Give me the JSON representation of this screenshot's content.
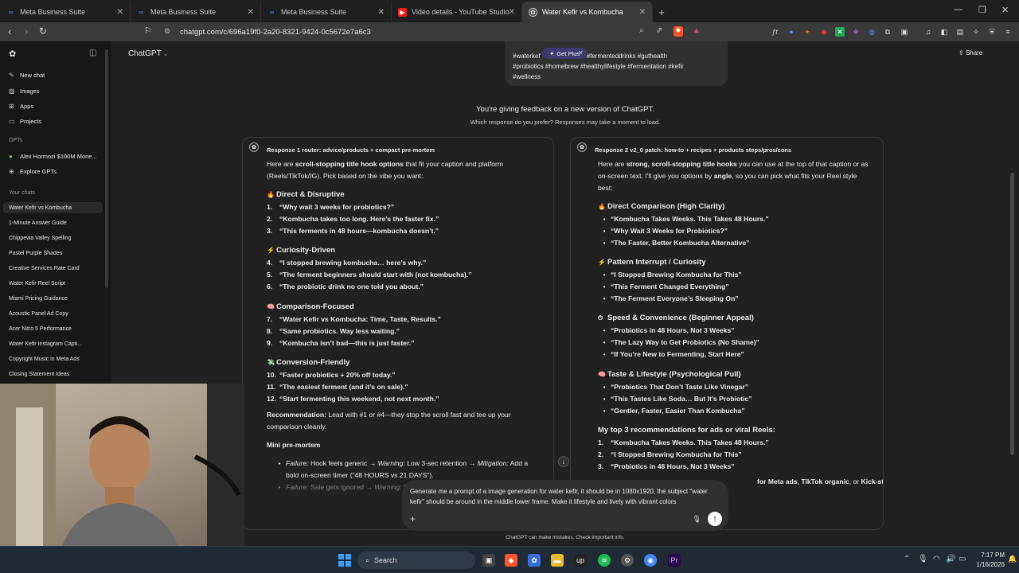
{
  "browser": {
    "tabs": [
      {
        "label": "Meta Business Suite",
        "icon": "meta-icon",
        "active": false
      },
      {
        "label": "Meta Business Suite",
        "icon": "meta-icon",
        "active": false
      },
      {
        "label": "Meta Business Suite",
        "icon": "meta-icon",
        "active": false
      },
      {
        "label": "Video details - YouTube Studio",
        "icon": "youtube-icon",
        "active": false
      },
      {
        "label": "Water Kefir vs Kombucha",
        "icon": "chatgpt-icon",
        "active": true
      }
    ],
    "url": "chatgpt.com/c/696a19f0-2a20-8321-9424-0c5672e7a6c3"
  },
  "sidebar": {
    "items": [
      {
        "label": "New chat",
        "icon": "new-chat-icon"
      },
      {
        "label": "Images",
        "icon": "images-icon"
      },
      {
        "label": "Apps",
        "icon": "apps-icon"
      },
      {
        "label": "Projects",
        "icon": "projects-icon"
      }
    ],
    "gpts_heading": "GPTs",
    "gpts": [
      "Alex Hormozi $100M Mone...",
      "Explore GPTs"
    ],
    "chats_heading": "Your chats",
    "chats": [
      "Water Kefir vs Kombucha",
      "1-Minute Answer Guide",
      "Chippewa Valley Spelling",
      "Pastel Purple Shades",
      "Creative Services Rate Card",
      "Water Kefir Reel Script",
      "Miami Pricing Guidance",
      "Acoustic Panel Ad Copy",
      "Acer Nitro 5 Performance",
      "Water Kefir Instagram Capti...",
      "Copyright Music in Meta Ads",
      "Closing Statement Ideas"
    ]
  },
  "header": {
    "model": "ChatGPT",
    "share": "Share",
    "get_plus": "Get Plus",
    "prev_hashtags_1": "#waterkef",
    "prev_hashtags_1b": "#fermenteddrinks #guthealth",
    "prev_hashtags_2": "#probiotics #homebrew #healthylifestyle #fermentation #kefir",
    "prev_hashtags_3": "#wellness"
  },
  "feedback": {
    "title": "You're giving feedback on a new version of ChatGPT.",
    "subtitle": "Which response do you prefer? Responses may take a moment to load."
  },
  "response1": {
    "header": "Response 1 router: advice/products + compact pre-mortem",
    "intro_a": "Here are ",
    "intro_b": "scroll-stopping title hook options",
    "intro_c": " that fit your caption and platform",
    "intro_d": "(Reels/TikTok/IG). Pick based on the vibe you want:",
    "sections": [
      {
        "title": "Direct & Disruptive",
        "emoji": "🔥",
        "items": [
          {
            "n": "1.",
            "t": "“Why wait 3 weeks for probiotics?”"
          },
          {
            "n": "2.",
            "t": "“Kombucha takes too long. Here’s the faster fix.”"
          },
          {
            "n": "3.",
            "t": "“This ferments in 48 hours—kombucha doesn’t.”"
          }
        ]
      },
      {
        "title": "Curiosity-Driven",
        "emoji": "⚡",
        "items": [
          {
            "n": "4.",
            "t": "“I stopped brewing kombucha… here’s why.”"
          },
          {
            "n": "5.",
            "t": "“The ferment beginners should start with (not kombucha).”"
          },
          {
            "n": "6.",
            "t": "“The probiotic drink no one told you about.”"
          }
        ]
      },
      {
        "title": "Comparison-Focused",
        "emoji": "🧠",
        "items": [
          {
            "n": "7.",
            "t": "“Water Kefir vs Kombucha: Time, Taste, Results.”"
          },
          {
            "n": "8.",
            "t": "“Same probiotics. Way less waiting.”"
          },
          {
            "n": "9.",
            "t": "“Kombucha isn’t bad—this is just faster.”"
          }
        ]
      },
      {
        "title": "Conversion-Friendly",
        "emoji": "💸",
        "items": [
          {
            "n": "10.",
            "t": "“Faster probiotics + 20% off today.”"
          },
          {
            "n": "11.",
            "t": "“The easiest ferment (and it’s on sale).”"
          },
          {
            "n": "12.",
            "t": "“Start fermenting this weekend, not next month.”"
          }
        ]
      }
    ],
    "rec_label": "Recommendation:",
    "rec_text": " Lead with #1 or #4—they stop the scroll fast and tee up your",
    "rec_text2": "comparison cleanly.",
    "premortem_title": "Mini pre-mortem",
    "pm1_a": "Failure:",
    "pm1_b": " Hook feels generic → ",
    "pm1_c": "Warning:",
    "pm1_d": " Low 3-sec retention → ",
    "pm1_e": "Mitigation:",
    "pm1_f": " Add a",
    "pm1_g": "bold on-screen timer (“48 HOURS vs 21 DAYS”).",
    "pm2_a": "Failure:",
    "pm2_b": " Sale gets ignored → ",
    "pm2_c": "Warning:",
    "pm2_d": " Sa"
  },
  "response2": {
    "header": "Response 2 v2_0 patch: how-to + recipes + products steps/pros/cons",
    "intro_a": "Here are ",
    "intro_b": "strong, scroll-stopping title hooks",
    "intro_c": " you can use at the top of that caption or as",
    "intro_d": "on-screen text. I’ll give you options by ",
    "intro_e": "angle",
    "intro_f": ", so you can pick what fits your Reel style",
    "intro_g": "best:",
    "sections": [
      {
        "title": "Direct Comparison (High Clarity)",
        "emoji": "🔥",
        "items": [
          "“Kombucha Takes Weeks. This Takes 48 Hours.”",
          "“Why Wait 3 Weeks for Probiotics?”",
          "“The Faster, Better Kombucha Alternative”"
        ]
      },
      {
        "title": "Pattern Interrupt / Curiosity",
        "emoji": "⚡",
        "items": [
          "“I Stopped Brewing Kombucha for This”",
          "“This Ferment Changed Everything”",
          "“The Ferment Everyone’s Sleeping On”"
        ]
      },
      {
        "title": "Speed & Convenience (Beginner Appeal)",
        "emoji": "⏱",
        "items": [
          "“Probiotics in 48 Hours, Not 3 Weeks”",
          "“The Lazy Way to Get Probiotics (No Shame)”",
          "“If You’re New to Fermenting, Start Here”"
        ]
      },
      {
        "title": "Taste & Lifestyle (Psychological Pull)",
        "emoji": "🧠",
        "items": [
          "“Probiotics That Don’t Taste Like Vinegar”",
          "“This Tastes Like Soda… But It’s Probiotic”",
          "“Gentler, Faster, Easier Than Kombucha”"
        ]
      }
    ],
    "top3_title": "My top 3 recommendations for ads or viral Reels:",
    "top3": [
      {
        "n": "1.",
        "t": "“Kombucha Takes Weeks. This Takes 48 Hours.”"
      },
      {
        "n": "2.",
        "t": "“I Stopped Brewing Kombucha for This”"
      },
      {
        "n": "3.",
        "t": "“Probiotics in 48 Hours, Not 3 Weeks”"
      }
    ],
    "cut_a": "for Meta ads",
    "cut_b": ", ",
    "cut_c": "TikTok organic",
    "cut_d": ", or ",
    "cut_e": "Kick-style"
  },
  "composer": {
    "text": "Generate me a prompt of a image generation for water kefir, it should be in 1080x1920, the subject \"water kefir\" should be around in the middle lower frame. Make it lifestyle and lively with vibrant colors"
  },
  "disclaimer": "ChatGPT can make mistakes. Check important info.",
  "taskbar": {
    "search": "Search",
    "time": "7:17 PM",
    "date": "1/16/2026"
  },
  "colors": {
    "background": "#212121",
    "sidebar": "#171717",
    "accent": "#7c5cff"
  }
}
